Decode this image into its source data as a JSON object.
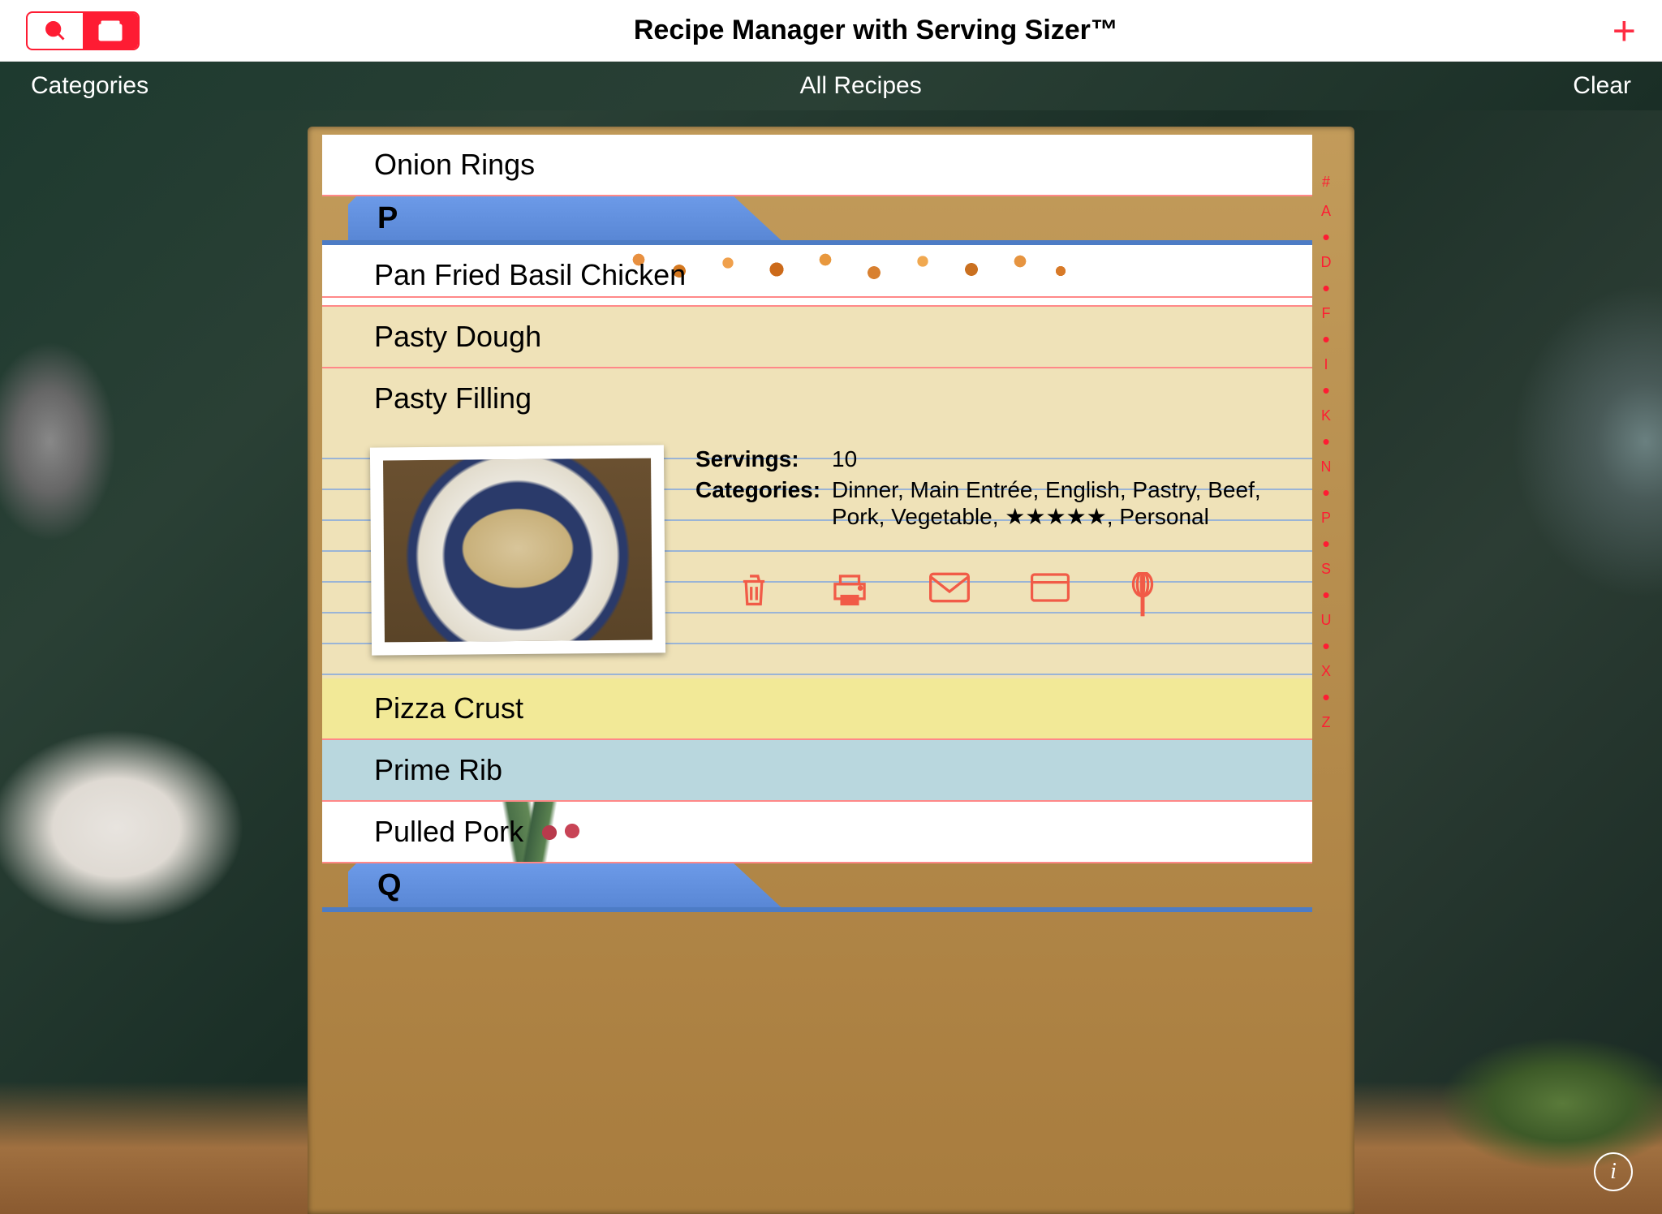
{
  "topbar": {
    "title": "Recipe Manager with Serving Sizer™",
    "segment_search_icon": "search",
    "segment_box_icon": "box"
  },
  "subbar": {
    "left": "Categories",
    "center": "All Recipes",
    "right": "Clear"
  },
  "sections": {
    "p_label": "P",
    "q_label": "Q"
  },
  "recipes": {
    "onion_rings": "Onion Rings",
    "pan_fried": "Pan Fried Basil Chicken",
    "pasty_dough": "Pasty Dough",
    "pasty_filling": "Pasty Filling",
    "pizza_crust": "Pizza Crust",
    "prime_rib": "Prime Rib",
    "pulled_pork": "Pulled Pork"
  },
  "detail": {
    "servings_label": "Servings:",
    "servings_value": "10",
    "categories_label": "Categories:",
    "categories_value": "Dinner, Main Entrée, English, Pastry, Beef, Pork, Vegetable, ★★★★★, Personal"
  },
  "index": {
    "hash": "#",
    "a": "A",
    "d": "D",
    "f": "F",
    "i": "I",
    "k": "K",
    "n": "N",
    "p": "P",
    "s": "S",
    "u": "U",
    "x": "X",
    "z": "Z"
  },
  "info": "i"
}
